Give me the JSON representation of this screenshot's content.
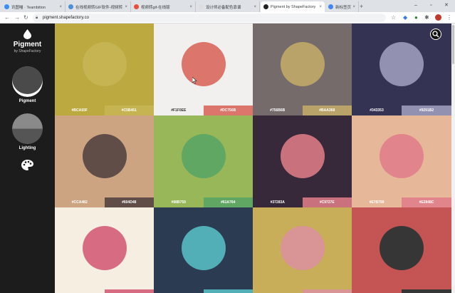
{
  "browser": {
    "tabs": [
      {
        "title": "讯图喵 · Teambition",
        "fav": "#3b8ef3"
      },
      {
        "title": "在线视频转GIF软件-视频转…",
        "fav": "#4a90d9"
      },
      {
        "title": "视频转gif-在线版",
        "fav": "#e74c3c"
      },
      {
        "title": "设计师必备配色靠谱",
        "fav": "#dddddd"
      },
      {
        "title": "Pigment by ShapeFactory",
        "fav": "#222222"
      },
      {
        "title": "新标签页",
        "fav": "#4285f4"
      }
    ],
    "url": "pigment.shapefactory.co"
  },
  "app": {
    "title": "Pigment",
    "subtitle": "by ShapeFactory",
    "modes": [
      {
        "label": "Pigment"
      },
      {
        "label": "Lighting"
      }
    ]
  },
  "cards": [
    {
      "bg": "#BCA93F",
      "circle": "#C5B451",
      "left": {
        "code": "#BCA93F",
        "bg": "#BCA93F"
      },
      "right": {
        "code": "#C5B451",
        "bg": "#C5B451"
      }
    },
    {
      "bg": "#F1F0EE",
      "circle": "#DC756B",
      "left": {
        "code": "#F1F0EE",
        "bg": "#F1F0EE"
      },
      "right": {
        "code": "#DC756B",
        "bg": "#DC756B"
      }
    },
    {
      "bg": "#756B6B",
      "circle": "#BAA368",
      "left": {
        "code": "#756B6B",
        "bg": "#756B6B"
      },
      "right": {
        "code": "#BAA368",
        "bg": "#BAA368"
      }
    },
    {
      "bg": "#343353",
      "circle": "#9291B2",
      "left": {
        "code": "#343353",
        "bg": "#343353"
      },
      "right": {
        "code": "#9291B2",
        "bg": "#9291B2"
      }
    },
    {
      "bg": "#CCA482",
      "circle": "#604D48",
      "left": {
        "code": "#CCA482",
        "bg": "#CCA482"
      },
      "right": {
        "code": "#604D48",
        "bg": "#604D48"
      }
    },
    {
      "bg": "#98B759",
      "circle": "#61A764",
      "left": {
        "code": "#98B759",
        "bg": "#98B759"
      },
      "right": {
        "code": "#61A764",
        "bg": "#61A764"
      }
    },
    {
      "bg": "#37283A",
      "circle": "#C9727E",
      "left": {
        "code": "#37283A",
        "bg": "#37283A"
      },
      "right": {
        "code": "#C9727E",
        "bg": "#C9727E"
      }
    },
    {
      "bg": "#E7B799",
      "circle": "#E2848C",
      "left": {
        "code": "#E7B799",
        "bg": "#E7B799"
      },
      "right": {
        "code": "#E2848C",
        "bg": "#E2848C"
      }
    },
    {
      "bg": "#F6EEE1",
      "circle": "#D76B82",
      "left": {
        "code": "",
        "bg": "#F6EEE1"
      },
      "right": {
        "code": "",
        "bg": "#D76B82"
      }
    },
    {
      "bg": "#2A3B52",
      "circle": "#52AFB7",
      "left": {
        "code": "",
        "bg": "#2A3B52"
      },
      "right": {
        "code": "",
        "bg": "#52AFB7"
      }
    },
    {
      "bg": "#C9AE5A",
      "circle": "#D99595",
      "left": {
        "code": "",
        "bg": "#C9AE5A"
      },
      "right": {
        "code": "",
        "bg": "#D99595"
      }
    },
    {
      "bg": "#C55455",
      "circle": "#363636",
      "left": {
        "code": "",
        "bg": "#C55455"
      },
      "right": {
        "code": "",
        "bg": "#363636"
      }
    }
  ]
}
